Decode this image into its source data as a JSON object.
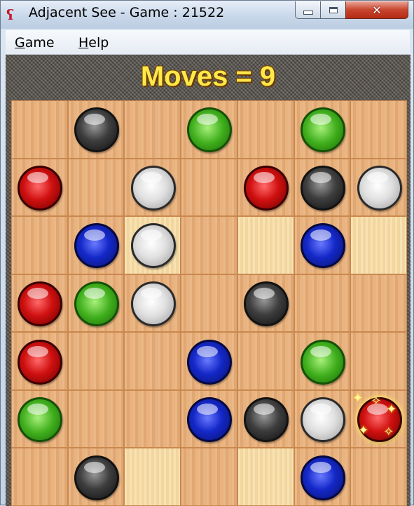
{
  "window": {
    "title": "Adjacent See - Game : 21522",
    "app_icon": "knot-icon",
    "minimize_icon": "minimize-icon",
    "maximize_icon": "maximize-icon",
    "close_icon": "close-icon",
    "close_glyph": "✕"
  },
  "menu": [
    {
      "label": "Game",
      "accel": "G"
    },
    {
      "label": "Help",
      "accel": "H"
    }
  ],
  "status": {
    "moves_text": "Moves = 9",
    "moves": 9
  },
  "board": {
    "rows": 7,
    "cols": 7,
    "cells": [
      [
        "",
        "black",
        "",
        "green",
        "",
        "green",
        ""
      ],
      [
        "red",
        "",
        "white",
        "",
        "red",
        "black",
        "white"
      ],
      [
        "",
        "blue",
        "white",
        "",
        "",
        "blue",
        ""
      ],
      [
        "red",
        "green",
        "white",
        "",
        "black",
        "",
        ""
      ],
      [
        "red",
        "",
        "",
        "blue",
        "",
        "green",
        ""
      ],
      [
        "green",
        "",
        "",
        "blue",
        "black",
        "white",
        "red"
      ],
      [
        "",
        "black",
        "",
        "",
        "",
        "blue",
        ""
      ]
    ],
    "highlighted": [
      [
        2,
        2
      ],
      [
        2,
        4
      ],
      [
        2,
        6
      ],
      [
        6,
        2
      ],
      [
        6,
        4
      ]
    ],
    "selected": [
      5,
      6
    ]
  },
  "colors": {
    "moves_text": "#ffe84a",
    "cell_dark": "#e8b07a",
    "cell_light": "#f6dca4",
    "frame": "#57524c"
  }
}
